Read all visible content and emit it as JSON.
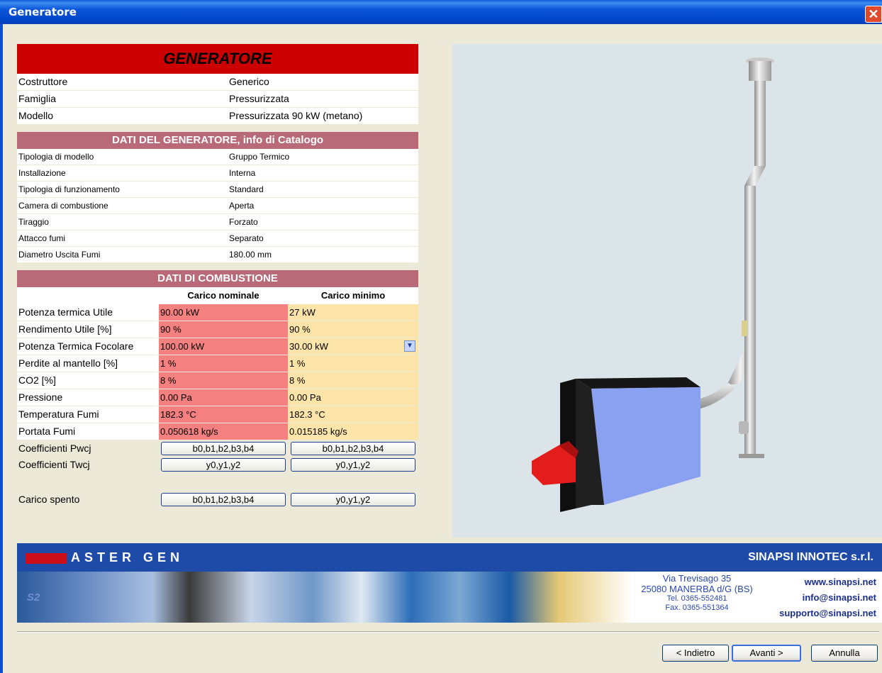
{
  "window": {
    "title": "Generatore",
    "close_icon": "close-icon"
  },
  "generatore": {
    "banner": "GENERATORE",
    "rows": [
      {
        "label": "Costruttore",
        "value": "Generico"
      },
      {
        "label": "Famiglia",
        "value": "Pressurizzata"
      },
      {
        "label": "Modello",
        "value": "Pressurizzata 90 kW (metano)"
      }
    ]
  },
  "dati_generatore": {
    "title": "DATI DEL GENERATORE, info di Catalogo",
    "rows": [
      {
        "label": "Tipologia di modello",
        "value": "Gruppo Termico"
      },
      {
        "label": "Installazione",
        "value": "Interna"
      },
      {
        "label": "Tipologia di funzionamento",
        "value": "Standard"
      },
      {
        "label": "Camera di combustione",
        "value": "Aperta"
      },
      {
        "label": "Tiraggio",
        "value": "Forzato"
      },
      {
        "label": "Attacco fumi",
        "value": "Separato"
      },
      {
        "label": "Diametro Uscita Fumi",
        "value": "180.00 mm"
      }
    ]
  },
  "combustione": {
    "title": "DATI DI COMBUSTIONE",
    "col_nominale": "Carico nominale",
    "col_minimo": "Carico minimo",
    "rows": [
      {
        "label": "Potenza termica Utile",
        "nominale": "90.00 kW",
        "minimo": "27 kW"
      },
      {
        "label": "Rendimento Utile [%]",
        "nominale": "90 %",
        "minimo": "90 %"
      },
      {
        "label": "Potenza Termica Focolare",
        "nominale": "100.00 kW",
        "minimo": "30.00 kW"
      },
      {
        "label": "Perdite al mantello [%]",
        "nominale": "1 %",
        "minimo": "1 %"
      },
      {
        "label": "CO2 [%]",
        "nominale": "8 %",
        "minimo": "8 %"
      },
      {
        "label": "Pressione",
        "nominale": "0.00 Pa",
        "minimo": "0.00 Pa"
      },
      {
        "label": "Temperatura Fumi",
        "nominale": "182.3 °C",
        "minimo": "182.3 °C"
      },
      {
        "label": "Portata Fumi",
        "nominale": "0.050618 kg/s",
        "minimo": "0.015185 kg/s"
      }
    ],
    "coeff_pwcj": {
      "label": "Coefficienti Pwcj",
      "btn1": "b0,b1,b2,b3,b4",
      "btn2": "b0,b1,b2,b3,b4"
    },
    "coeff_twcj": {
      "label": "Coefficienti Twcj",
      "btn1": "y0,y1,y2",
      "btn2": "y0,y1,y2"
    },
    "carico_spento": {
      "label": "Carico spento",
      "btn1": "b0,b1,b2,b3,b4",
      "btn2": "y0,y1,y2"
    }
  },
  "footer": {
    "product": "ASTER GEN",
    "company": "SINAPSI INNOTEC s.r.l.",
    "photo_label": "S2",
    "address_line1": "Via Trevisago 35",
    "address_line2": "25080 MANERBA d/G (BS)",
    "tel": "Tel. 0365-552481",
    "fax": "Fax. 0365-551364",
    "web": "www.sinapsi.net",
    "info": "info@sinapsi.net",
    "support": "supporto@sinapsi.net"
  },
  "buttons": {
    "back": "< Indietro",
    "next": "Avanti >",
    "cancel": "Annulla"
  },
  "colors": {
    "banner_red": "#cc0000",
    "section_header": "#b86a78",
    "nominale_bg": "#f58080",
    "minimo_bg": "#fde4a8",
    "xp_blue": "#0a4fd0"
  }
}
